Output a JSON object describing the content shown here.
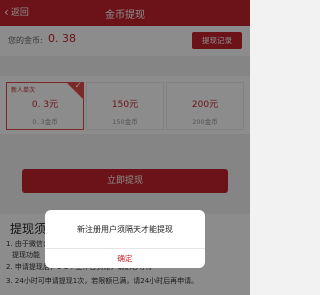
{
  "nav": {
    "back_label": "返回",
    "title": "金币提现"
  },
  "balance": {
    "label": "您的金币:",
    "value": "0. 38",
    "record_button": "提现记录"
  },
  "options": [
    {
      "badge": "新人单次",
      "amount": "0. 3元",
      "coins": "0. 3金币",
      "selected": true
    },
    {
      "badge": "",
      "amount": "150元",
      "coins": "150金币",
      "selected": false
    },
    {
      "badge": "",
      "amount": "200元",
      "coins": "200金币",
      "selected": false
    }
  ],
  "withdraw_button": "立即提现",
  "rules": {
    "title": "提现须知",
    "lines": [
      "1. 由于微信公众号限制，部分用户可能无法支持",
      "提现功能",
      "2. 申请提现后，1-3个工作日到账，请耐心等待",
      "3. 24小时可申请提现1次，若限额已满，请24小时后再申请。"
    ]
  },
  "dialog": {
    "message": "新注册用户须隔天才能提现",
    "confirm": "确定"
  },
  "colors": {
    "brand_red": "#c4242c"
  }
}
